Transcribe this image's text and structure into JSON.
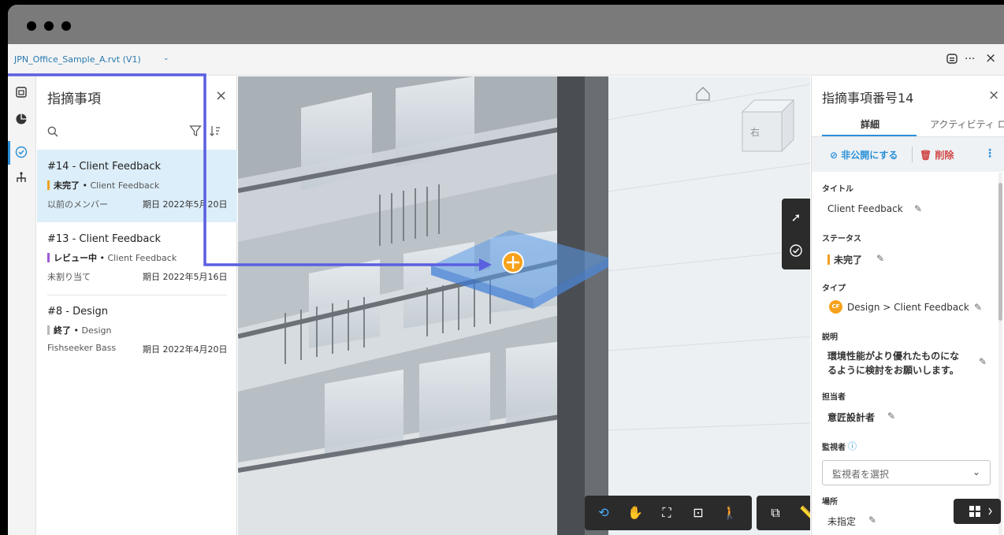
{
  "window": {
    "file_name": "JPN_Office_Sample_A.rvt (V1)",
    "file_chevron": "⌄",
    "more_label": "···",
    "close_label": "×"
  },
  "leftbar": {
    "icons": [
      "sheets-icon",
      "models-icon",
      "issues-icon",
      "hierarchy-icon"
    ],
    "active": "issues-icon"
  },
  "issues": {
    "title": "指摘事項",
    "close_label": "×",
    "search_placeholder": "",
    "items": [
      {
        "title": "#14 - Client Feedback",
        "status": "未完了",
        "status_color": "#f0a020",
        "type": "Client Feedback",
        "assignee": "以前のメンバー",
        "due": "期日 2022年5月20日",
        "selected": true
      },
      {
        "title": "#13 - Client Feedback",
        "status": "レビュー中",
        "status_color": "#a05ad6",
        "type": "Client Feedback",
        "assignee": "未割り当て",
        "due": "期日 2022年5月16日",
        "selected": false
      },
      {
        "title": "#8 - Design",
        "status": "終了",
        "status_color": "#b8b8b8",
        "type": "Design",
        "assignee": "Fishseeker Bass",
        "due": "期日 2022年4月20日",
        "selected": false
      }
    ],
    "separator": " • "
  },
  "viewport": {
    "viewcube_label": "右",
    "pin_color": "#f7a21b",
    "callout_color": "#5a5fe0",
    "toolbar_groups": [
      [
        "orbit-icon",
        "pan-icon",
        "fit-icon",
        "zoom-window-icon",
        "walk-icon"
      ],
      [
        "section-box-icon",
        "measure-icon"
      ],
      [
        "settings-icon",
        "properties-icon",
        "fullscreen-icon"
      ]
    ]
  },
  "detail": {
    "title": "指摘事項番号14",
    "close_label": "×",
    "tabs": [
      "詳細",
      "アクティビティ ログ"
    ],
    "actions": {
      "unpublish": "非公開にする",
      "delete": "削除",
      "more": "⋮"
    },
    "fields": {
      "title_label": "タイトル",
      "title_value": "Client Feedback",
      "status_label": "ステータス",
      "status_value": "未完了",
      "status_color": "#f0a020",
      "type_label": "タイプ",
      "type_badge": "CF",
      "type_value": "Design > Client Feedback",
      "description_label": "説明",
      "description_line1": "環境性能がより優れたものにな",
      "description_line2": "るように検討をお願いします。",
      "assignee_label": "担当者",
      "assignee_value": "意匠設計者",
      "watchers_label": "監視者",
      "watchers_placeholder": "監視者を選択",
      "location_label": "場所",
      "location_value": "未指定"
    }
  }
}
